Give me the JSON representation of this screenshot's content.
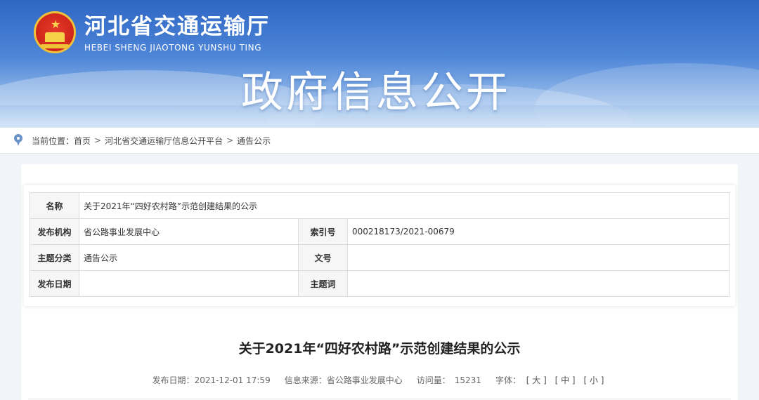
{
  "header": {
    "site_title": "河北省交通运输厅",
    "site_subtitle": "HEBEI SHENG JIAOTONG YUNSHU TING",
    "banner_title": "政府信息公开"
  },
  "breadcrumb": {
    "label": "当前位置：",
    "items": [
      "首页",
      "河北省交通运输厅信息公开平台",
      "通告公示"
    ],
    "separator": ">"
  },
  "meta": {
    "name_label": "名称",
    "name_value": "关于2021年“四好农村路”示范创建结果的公示",
    "org_label": "发布机构",
    "org_value": "省公路事业发展中心",
    "index_label": "索引号",
    "index_value": "000218173/2021-00679",
    "category_label": "主题分类",
    "category_value": "通告公示",
    "docno_label": "文号",
    "docno_value": "",
    "date_label": "发布日期",
    "date_value": "",
    "keyword_label": "主题词",
    "keyword_value": ""
  },
  "article": {
    "title": "关于2021年“四好农村路”示范创建结果的公示",
    "publish_date_label": "发布日期：",
    "publish_date": "2021-12-01 17:59",
    "source_label": "信息来源：",
    "source": "省公路事业发展中心",
    "views_label": "访问量：",
    "views": "15231",
    "font_label": "字体：",
    "font_large": "[ 大 ]",
    "font_medium": "[ 中 ]",
    "font_small": "[ 小 ]"
  },
  "colors": {
    "banner_top": "#2f66c4",
    "emblem_red": "#d42a1e",
    "emblem_gold": "#f0c23a",
    "pin": "#6a93c9"
  }
}
